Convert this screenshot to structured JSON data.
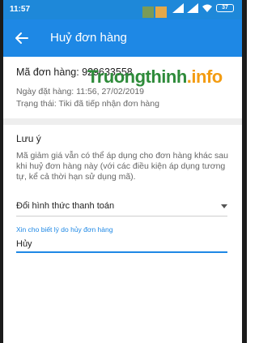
{
  "status_bar": {
    "time": "11:57",
    "battery": "37"
  },
  "app_bar": {
    "title": "Huỷ đơn hàng"
  },
  "order": {
    "id_label": "Mã đơn hàng: 929633558",
    "date_label": "Ngày đặt hàng: 11:56, 27/02/2019",
    "status_label": "Trạng thái: Tiki đã tiếp nhận đơn hàng"
  },
  "note": {
    "title": "Lưu ý",
    "text": "Mã giảm giá vẫn có thể áp dụng cho đơn hàng khác sau khi huỷ đơn hàng này (với các điều kiện áp dụng tương tự, kể cả thời hạn sử dụng mã)."
  },
  "reason_select": {
    "value": "Đổi hình thức thanh toán"
  },
  "reason_input": {
    "label": "Xin cho biết lý do hủy đơn hàng",
    "value": "Hủy"
  },
  "watermark": {
    "part1": "Truongthinh",
    "part2": ".info"
  },
  "colors": {
    "primary": "#1e88e5",
    "status_bar": "#1e88d9",
    "divider": "#eeeeee",
    "watermark_green": "#2e8b3a",
    "watermark_orange": "#f39c12"
  }
}
